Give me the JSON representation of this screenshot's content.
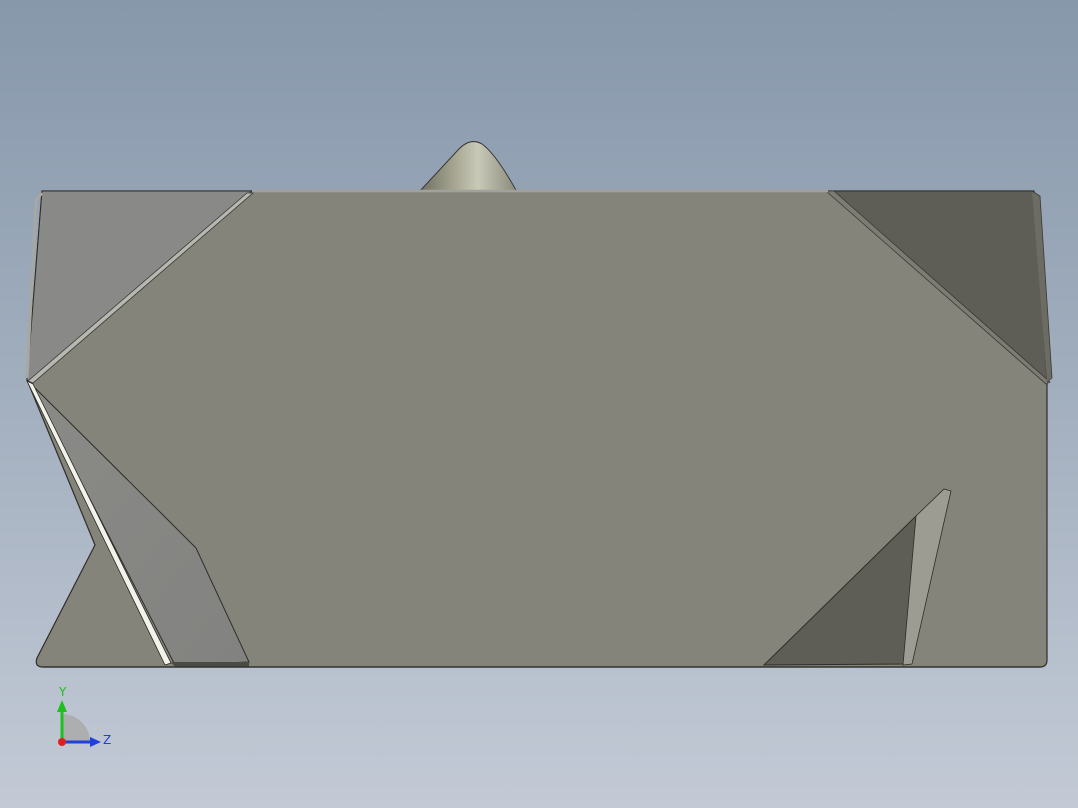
{
  "view": {
    "background_top": "#8798ab",
    "background_bottom": "#c3cad6",
    "model_face_color": "#84847a",
    "model_light_face_color": "#898987",
    "model_dark_face_color": "#5e5e56",
    "cone_color": "#aeae9c"
  },
  "triad": {
    "y_label": "Y",
    "z_label": "Z",
    "y_color": "#1fbf1f",
    "z_color": "#1f3fdf",
    "x_color": "#df1f1f",
    "y_icon": "y-axis-arrow-icon",
    "z_icon": "z-axis-arrow-icon",
    "x_icon": "x-axis-origin-icon"
  }
}
